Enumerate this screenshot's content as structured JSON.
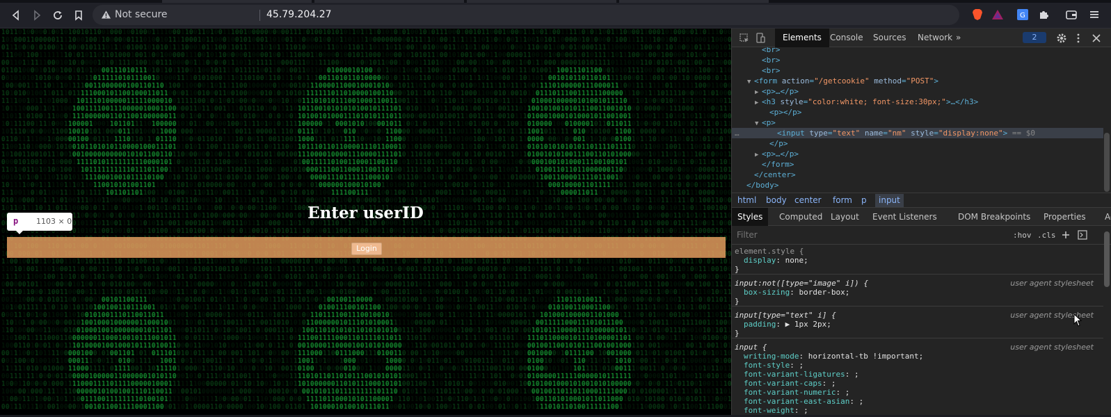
{
  "browser": {
    "security_label": "Not secure",
    "url": "45.79.204.27"
  },
  "page": {
    "heading": "Enter userID",
    "login_label": "Login",
    "matrix_color": "#21d84a",
    "bar_color": "#f0a564"
  },
  "tooltip": {
    "tag": "p",
    "dimensions": "1103 × 0"
  },
  "devtools": {
    "tabs": [
      "Elements",
      "Console",
      "Sources",
      "Network"
    ],
    "more": "»",
    "badge": "2",
    "dom_lines": [
      {
        "indent": 3,
        "html": "<br>"
      },
      {
        "indent": 3,
        "html": "<br>"
      },
      {
        "indent": 3,
        "html": "<br>"
      },
      {
        "indent": 2,
        "arrow": "▼",
        "html": "<form action=\"/getcookie\" method=\"POST\">"
      },
      {
        "indent": 3,
        "arrow": "▶",
        "html": "<p>…</p>"
      },
      {
        "indent": 3,
        "arrow": "▶",
        "html": "<h3 style=\"color:white; font-size:30px;\">…</h3>"
      },
      {
        "indent": 4,
        "html": "<p></p>"
      },
      {
        "indent": 3,
        "arrow": "▼",
        "html": "<p>"
      },
      {
        "indent": 5,
        "html": "<input type=\"text\" name=\"nm\" style=\"display:none\"> == $0",
        "selected": true
      },
      {
        "indent": 4,
        "html": "</p>"
      },
      {
        "indent": 3,
        "arrow": "▶",
        "html": "<p>…</p>"
      },
      {
        "indent": 3,
        "html": "</form>"
      },
      {
        "indent": 2,
        "html": "</center>"
      },
      {
        "indent": 1,
        "html": "</body>"
      }
    ],
    "breadcrumbs": [
      "html",
      "body",
      "center",
      "form",
      "p",
      "input"
    ],
    "style_tabs": [
      "Styles",
      "Computed",
      "Layout",
      "Event Listeners",
      "DOM Breakpoints",
      "Properties",
      "Accessibility"
    ],
    "filter_placeholder": "Filter",
    "hov": ":hov",
    "cls": ".cls",
    "rules": [
      {
        "selector": "element.style {",
        "source": "",
        "props": [
          [
            "display",
            "none;"
          ]
        ]
      },
      {
        "selector": "input:not([type=\"image\" i]) {",
        "source": "user agent stylesheet",
        "props": [
          [
            "box-sizing",
            "border-box;"
          ]
        ]
      },
      {
        "selector": "input[type=\"text\" i] {",
        "source": "user agent stylesheet",
        "props": [
          [
            "padding",
            "▶ 1px 2px;"
          ]
        ]
      },
      {
        "selector": "input {",
        "source": "user agent stylesheet",
        "props": [
          [
            "writing-mode",
            "horizontal-tb !important;"
          ],
          [
            "font-style",
            ";"
          ],
          [
            "font-variant-ligatures",
            ";"
          ],
          [
            "font-variant-caps",
            ";"
          ],
          [
            "font-variant-numeric",
            ";"
          ],
          [
            "font-variant-east-asian",
            ";"
          ],
          [
            "font-weight",
            ";"
          ]
        ]
      }
    ]
  }
}
